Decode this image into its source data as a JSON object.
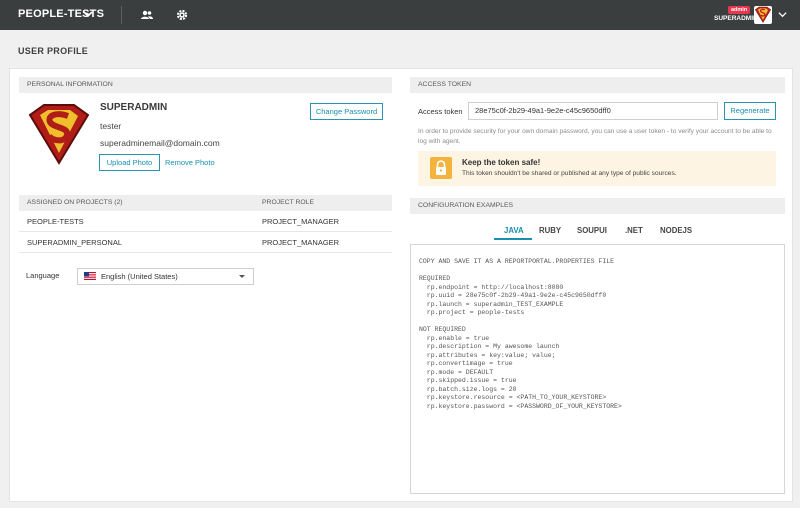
{
  "topbar": {
    "project": "PEOPLE-TESTS",
    "badge": "admin",
    "user": "SUPERADMIN"
  },
  "page_title": "USER PROFILE",
  "personal": {
    "heading": "PERSONAL INFORMATION",
    "name": "SUPERADMIN",
    "login": "tester",
    "email": "superadminemail@domain.com",
    "change_password": "Change Password",
    "upload_photo": "Upload Photo",
    "remove_photo": "Remove Photo"
  },
  "projects": {
    "col_project": "ASSIGNED ON PROJECTS (2)",
    "col_role": "PROJECT ROLE",
    "rows": [
      {
        "name": "PEOPLE-TESTS",
        "role": "PROJECT_MANAGER"
      },
      {
        "name": "SUPERADMIN_PERSONAL",
        "role": "PROJECT_MANAGER"
      }
    ]
  },
  "language": {
    "label": "Language",
    "selected": "English (United States)"
  },
  "token": {
    "heading": "ACCESS TOKEN",
    "label": "Access token",
    "value": "28e75c0f-2b29-49a1-9e2e-c45c9650dff0",
    "regenerate": "Regenerate",
    "description": "In order to provide security for your own domain password, you can use a user token - to verify your account to be able to log with agent.",
    "warning_title": "Keep the token safe!",
    "warning_text": "This token shouldn't be shared or published at any type of public sources."
  },
  "config": {
    "heading": "CONFIGURATION EXAMPLES",
    "tabs": [
      "JAVA",
      "RUBY",
      "SOUPUI",
      ".NET",
      "NODEJS"
    ],
    "active_tab": "JAVA",
    "code": "COPY AND SAVE IT AS A REPORTPORTAL.PROPERTIES FILE\n\nREQUIRED\n  rp.endpoint = http://localhost:8080\n  rp.uuid = 28e75c0f-2b29-49a1-9e2e-c45c9650dff0\n  rp.launch = superadmin_TEST_EXAMPLE\n  rp.project = people-tests\n\nNOT REQUIRED\n  rp.enable = true\n  rp.description = My awesome launch\n  rp.attributes = key:value; value;\n  rp.convertimage = true\n  rp.mode = DEFAULT\n  rp.skipped.issue = true\n  rp.batch.size.logs = 20\n  rp.keystore.resource = <PATH_TO_YOUR_KEYSTORE>\n  rp.keystore.password = <PASSWORD_OF_YOUR_KEYSTORE>"
  },
  "colors": {
    "topbar": "#3b3e3f",
    "accent": "#178fad",
    "badge": "#e8384f",
    "warning": "#f3b33d"
  }
}
